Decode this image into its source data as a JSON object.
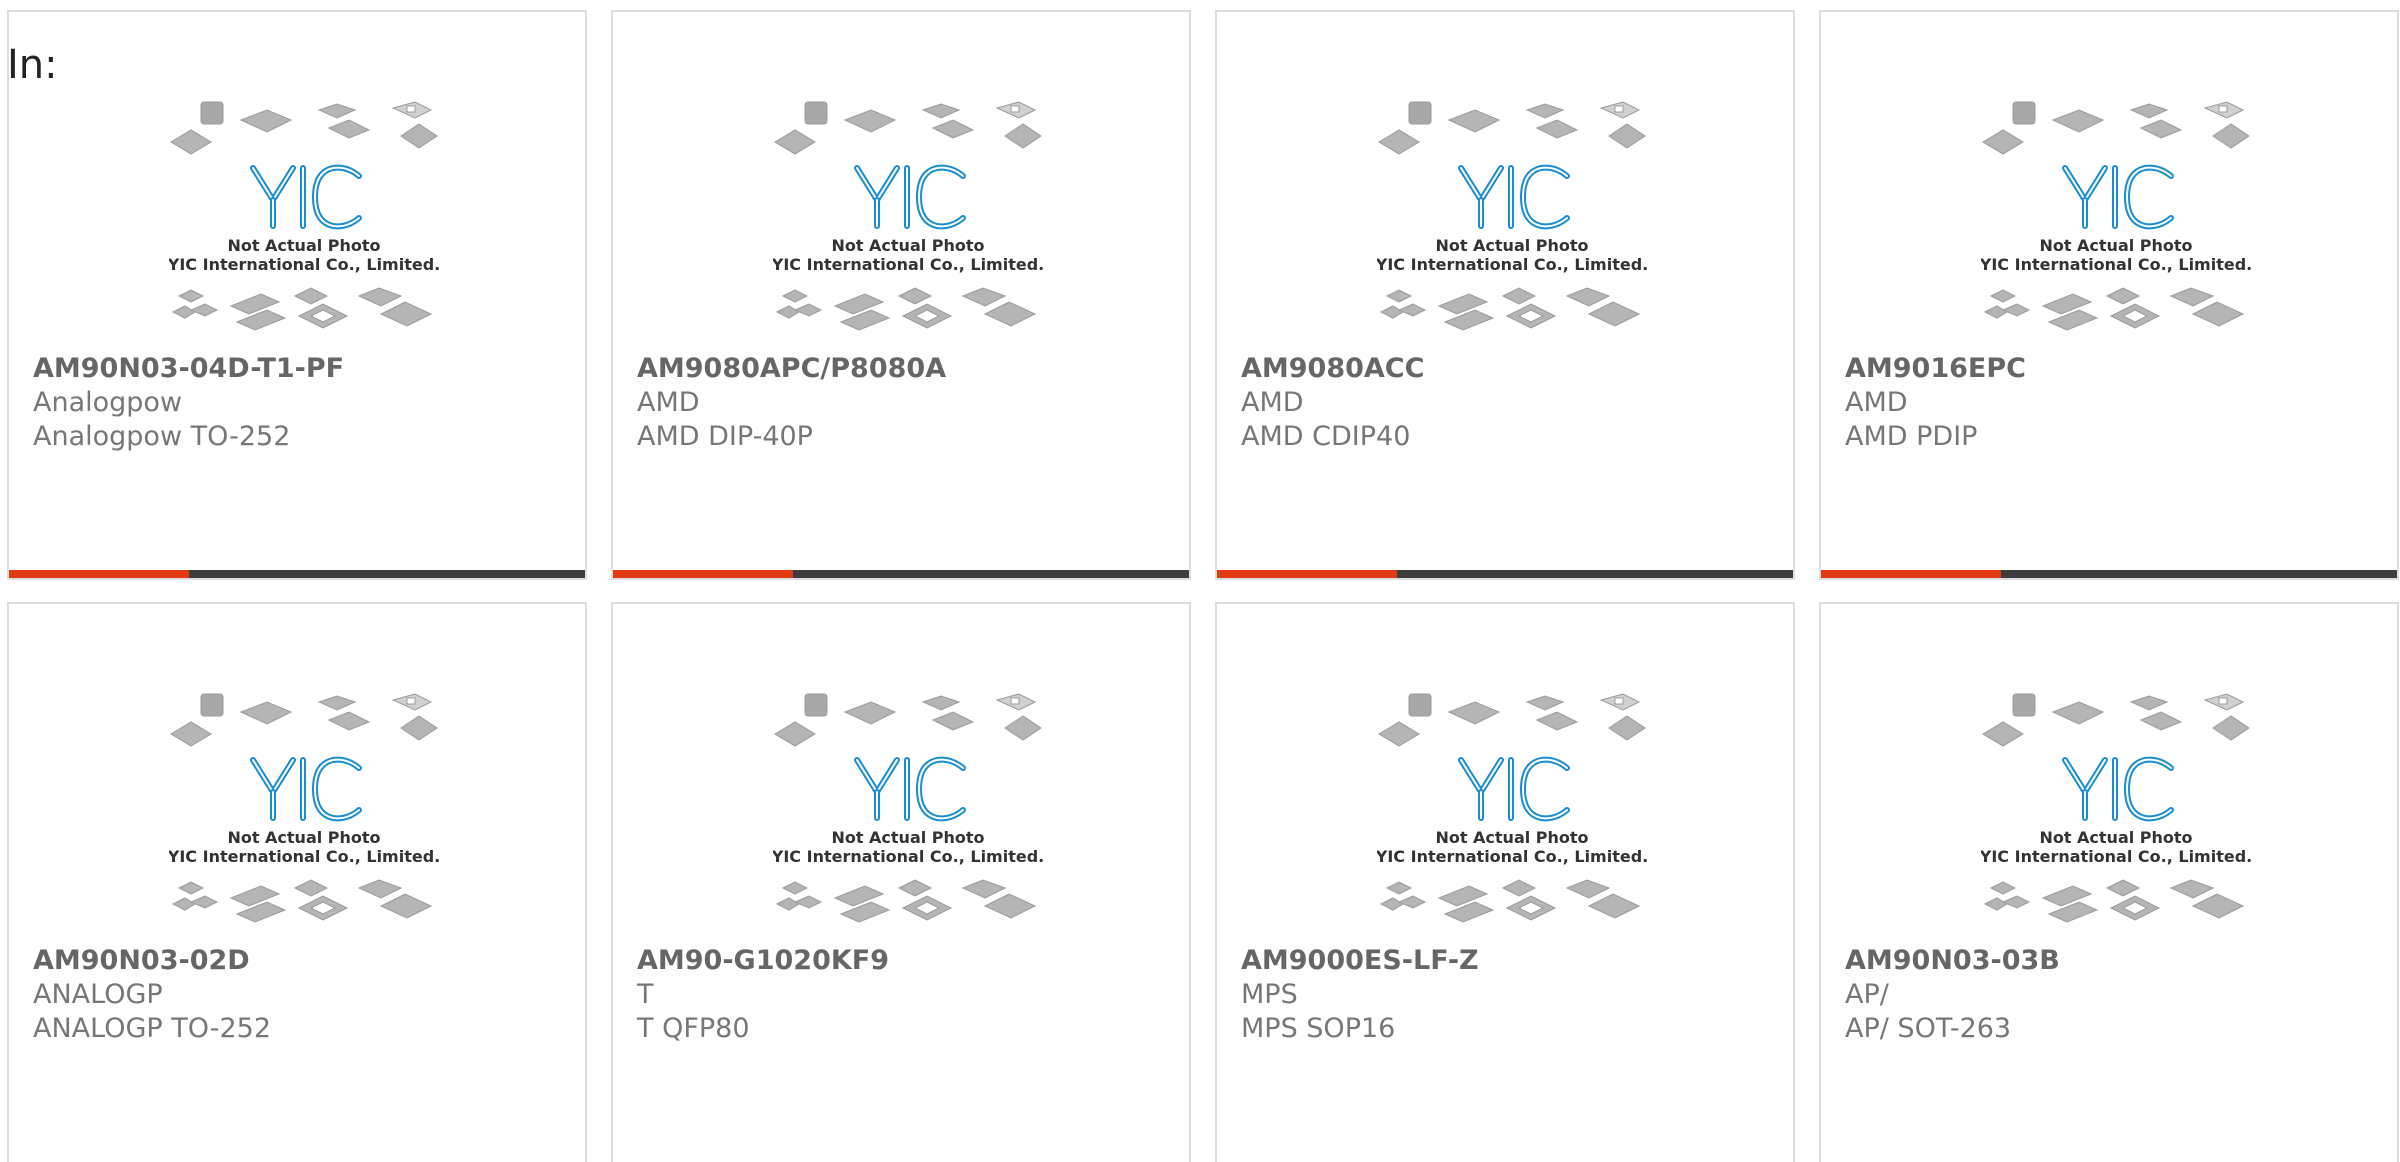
{
  "top_label": "In:",
  "placeholder": {
    "brand": "YIC",
    "line1": "Not Actual Photo",
    "line2": "YIC International Co., Limited.",
    "brand_color": "#1a8ed0"
  },
  "products": [
    {
      "part": "AM90N03-04D-T1-PF",
      "manufacturer": "Analogpow",
      "package": "Analogpow TO-252"
    },
    {
      "part": "AM9080APC/P8080A",
      "manufacturer": "AMD",
      "package": "AMD DIP-40P"
    },
    {
      "part": "AM9080ACC",
      "manufacturer": "AMD",
      "package": "AMD CDIP40"
    },
    {
      "part": "AM9016EPC",
      "manufacturer": "AMD",
      "package": "AMD PDIP"
    },
    {
      "part": "AM90N03-02D",
      "manufacturer": "ANALOGP",
      "package": "ANALOGP TO-252"
    },
    {
      "part": "AM90-G1020KF9",
      "manufacturer": "T",
      "package": "T QFP80"
    },
    {
      "part": "AM9000ES-LF-Z",
      "manufacturer": "MPS",
      "package": "MPS SOP16"
    },
    {
      "part": "AM90N03-03B",
      "manufacturer": "AP/",
      "package": "AP/ SOT-263"
    }
  ],
  "colors": {
    "accent": "#e33a12",
    "bar_dark": "#3d3d3d",
    "border": "#dddddd"
  }
}
